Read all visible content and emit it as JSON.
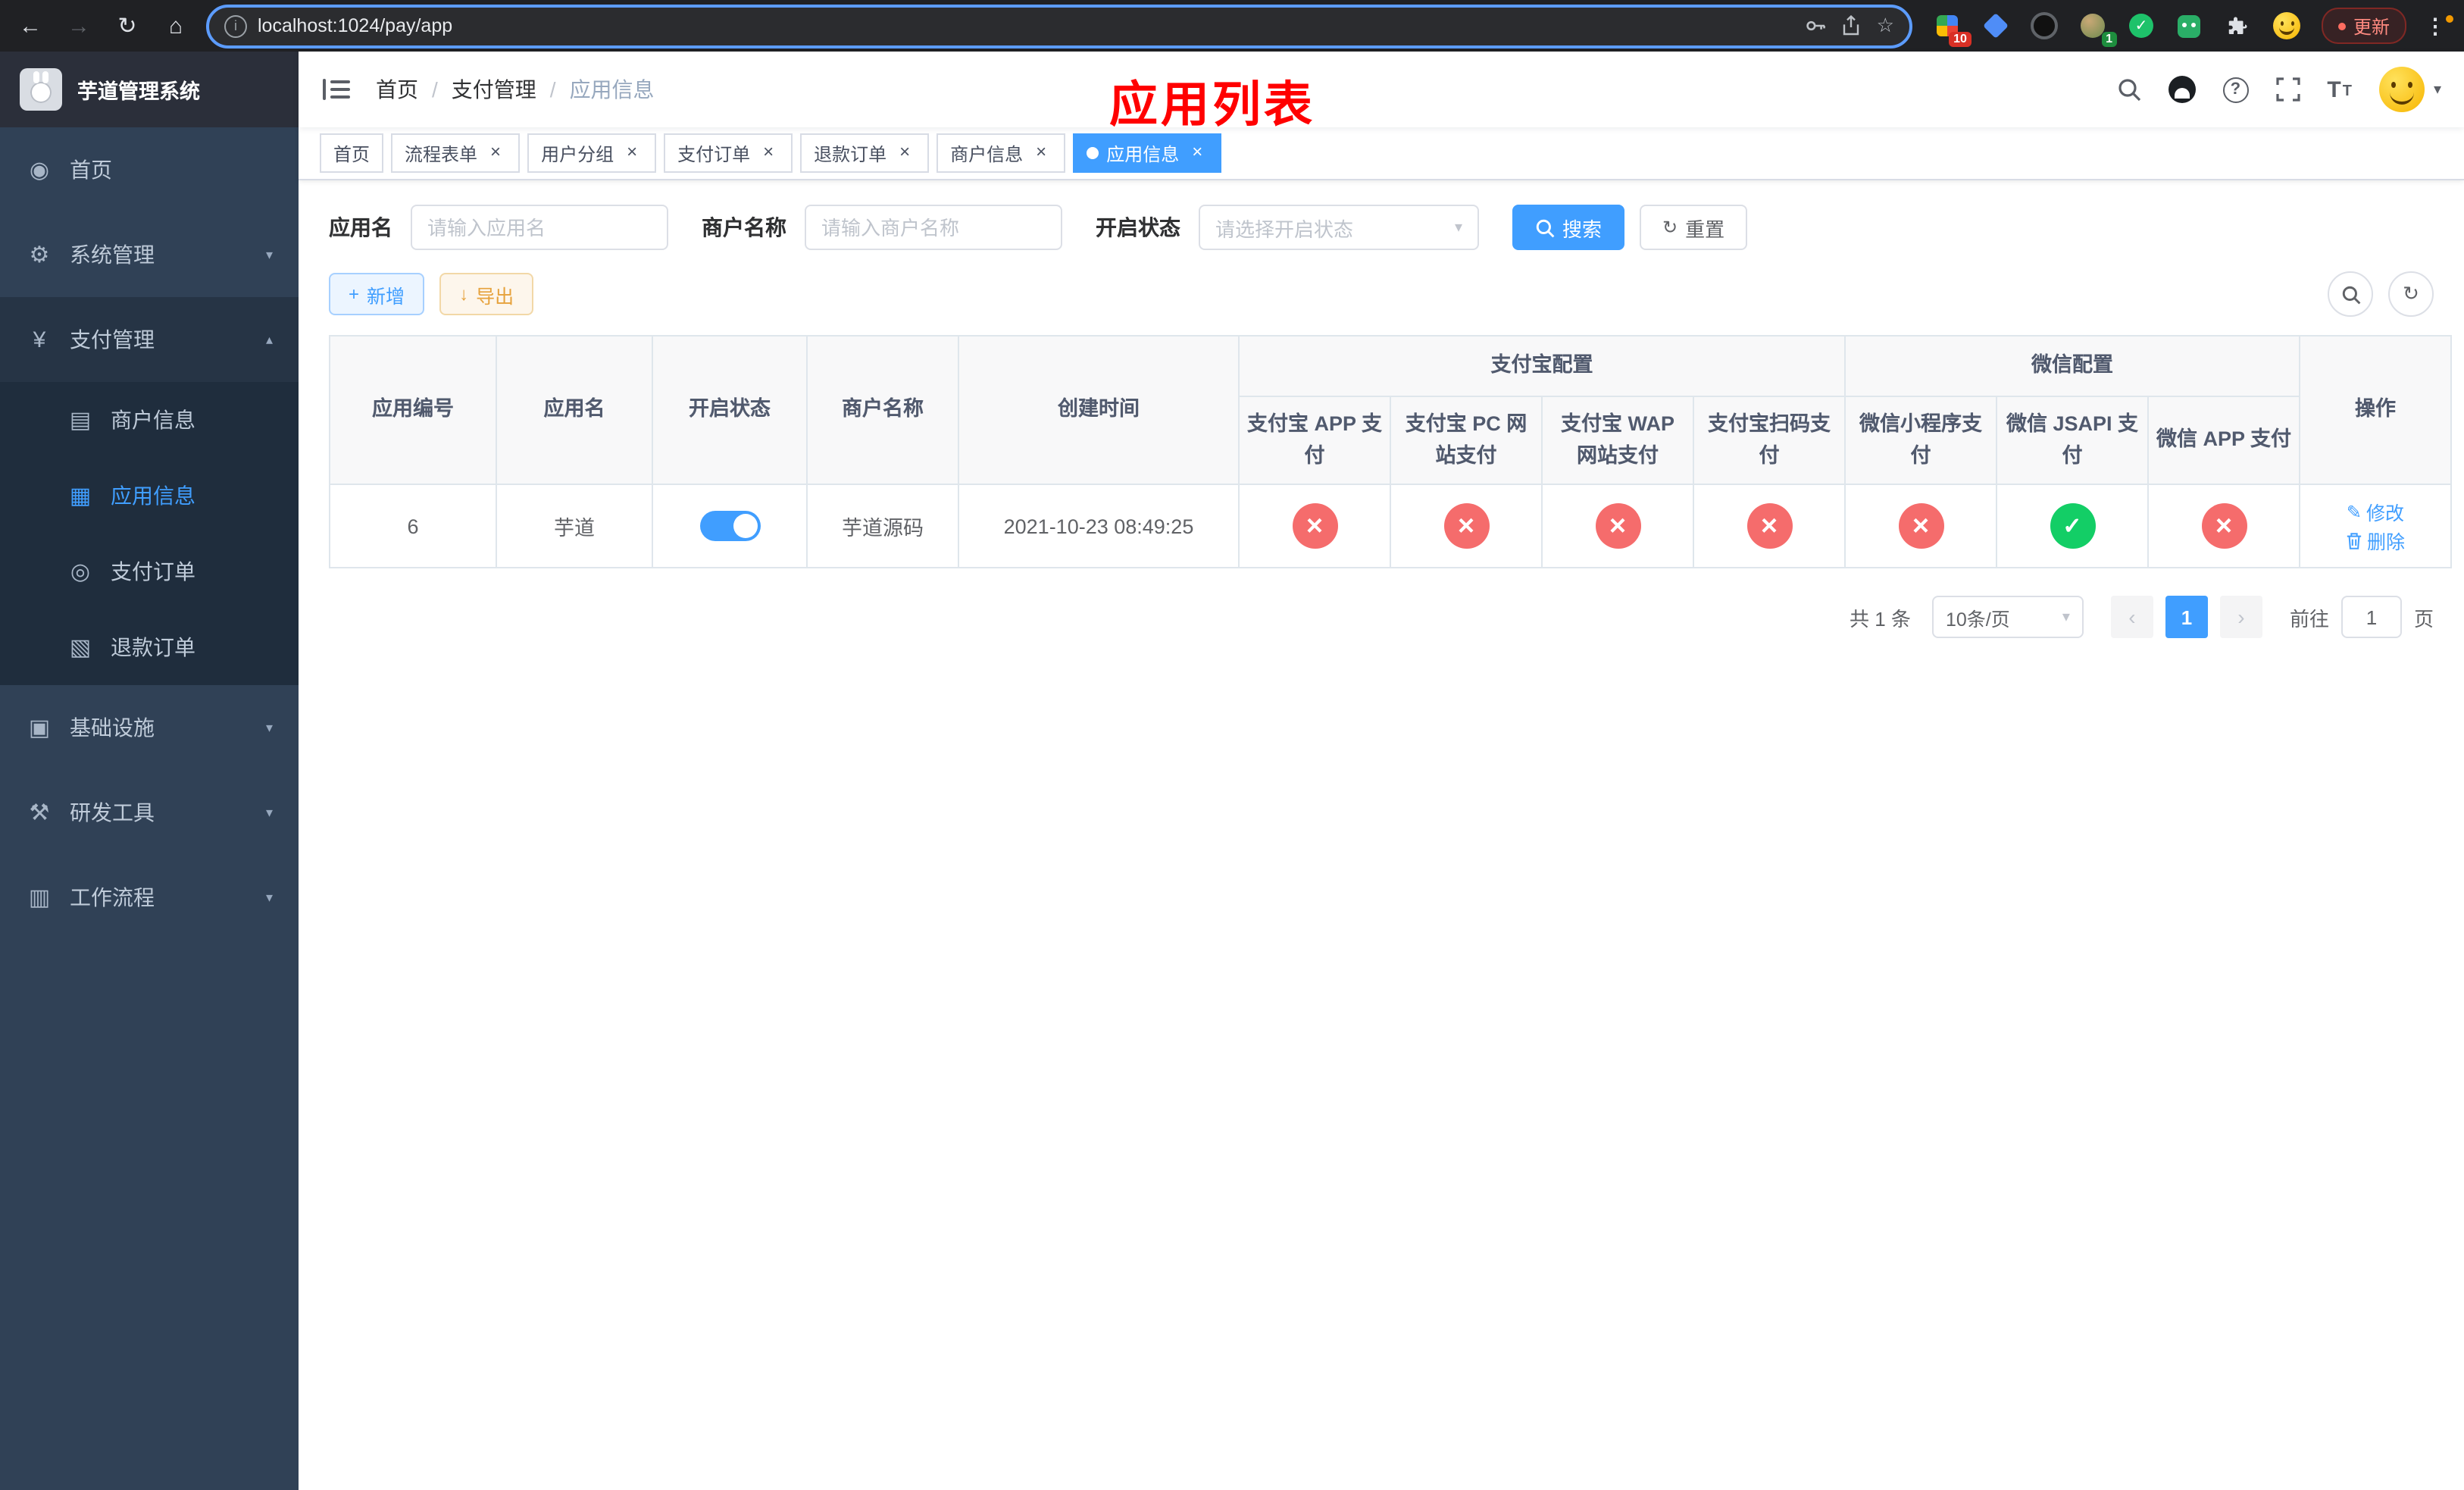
{
  "browser": {
    "url": "localhost:1024/pay/app",
    "update_label": "更新",
    "ext_grid_badge": "10",
    "ext_profile_badge": "1"
  },
  "icons": {
    "dashboard": "◉",
    "system": "⚙",
    "payment": "¥",
    "merchant": "▤",
    "app_info": "▦",
    "pay_order": "◎",
    "refund_order": "▧",
    "infrastructure": "▣",
    "dev_tools": "⚒",
    "workflow": "▥",
    "back": "←",
    "forward": "→",
    "reload": "↻",
    "home": "⌂",
    "star": "☆",
    "kebab": "⋮",
    "caret": "▾",
    "plus": "+",
    "download": "↓",
    "refresh": "↻",
    "edit": "✎",
    "font_large": "T",
    "font_small": "T"
  },
  "sidebar": {
    "title": "芋道管理系统",
    "items": [
      {
        "label": "首页",
        "icon": "dashboard"
      },
      {
        "label": "系统管理",
        "icon": "system",
        "expandable": true
      },
      {
        "label": "支付管理",
        "icon": "payment",
        "expandable": true,
        "expanded": true,
        "children": [
          {
            "label": "商户信息",
            "icon": "merchant",
            "active": false
          },
          {
            "label": "应用信息",
            "icon": "app_info",
            "active": true
          },
          {
            "label": "支付订单",
            "icon": "pay_order",
            "active": false
          },
          {
            "label": "退款订单",
            "icon": "refund_order",
            "active": false
          }
        ]
      },
      {
        "label": "基础设施",
        "icon": "infrastructure",
        "expandable": true
      },
      {
        "label": "研发工具",
        "icon": "dev_tools",
        "expandable": true
      },
      {
        "label": "工作流程",
        "icon": "workflow",
        "expandable": true
      }
    ]
  },
  "header": {
    "breadcrumb": [
      "首页",
      "支付管理",
      "应用信息"
    ],
    "breadcrumb_separator": "/",
    "page_title": "应用列表"
  },
  "tags": [
    {
      "label": "首页",
      "closable": false,
      "active": false
    },
    {
      "label": "流程表单",
      "closable": true,
      "active": false
    },
    {
      "label": "用户分组",
      "closable": true,
      "active": false
    },
    {
      "label": "支付订单",
      "closable": true,
      "active": false
    },
    {
      "label": "退款订单",
      "closable": true,
      "active": false
    },
    {
      "label": "商户信息",
      "closable": true,
      "active": false
    },
    {
      "label": "应用信息",
      "closable": true,
      "active": true
    }
  ],
  "filters": {
    "app_name_label": "应用名",
    "app_name_placeholder": "请输入应用名",
    "app_name_value": "",
    "merchant_label": "商户名称",
    "merchant_placeholder": "请输入商户名称",
    "merchant_value": "",
    "status_label": "开启状态",
    "status_placeholder": "请选择开启状态",
    "search_label": "搜索",
    "reset_label": "重置"
  },
  "toolbar": {
    "add_label": "新增",
    "export_label": "导出"
  },
  "table": {
    "main_columns": [
      "应用编号",
      "应用名",
      "开启状态",
      "商户名称",
      "创建时间"
    ],
    "group_columns": [
      {
        "label": "支付宝配置",
        "children": [
          "支付宝 APP 支付",
          "支付宝 PC 网站支付",
          "支付宝 WAP 网站支付",
          "支付宝扫码支付"
        ]
      },
      {
        "label": "微信配置",
        "children": [
          "微信小程序支付",
          "微信 JSAPI 支付",
          "微信 APP 支付"
        ]
      }
    ],
    "action_column": "操作",
    "rows": [
      {
        "id": "6",
        "name": "芋道",
        "enabled": true,
        "merchant": "芋道源码",
        "created_at": "2021-10-23 08:49:25",
        "configs": [
          false,
          false,
          false,
          false,
          false,
          true,
          false
        ],
        "actions": {
          "edit": "修改",
          "delete": "删除"
        }
      }
    ]
  },
  "pagination": {
    "total_text": "共 1 条",
    "page_size_text": "10条/页",
    "prev": "‹",
    "page": "1",
    "next": "›",
    "goto_label": "前往",
    "goto_value": "1",
    "goto_unit": "页"
  },
  "colors": {
    "primary": "#409eff",
    "success": "#13ce66",
    "danger": "#f56c6c",
    "warning": "#e6a23c",
    "title_red": "#ff0000",
    "sidebar_bg": "#304156",
    "submenu_bg": "#1f2d3d"
  }
}
